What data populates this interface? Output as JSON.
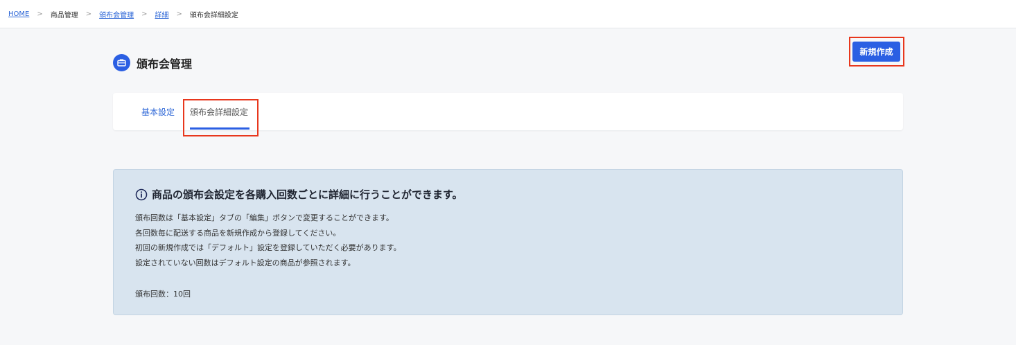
{
  "breadcrumb": {
    "items": [
      {
        "label": "HOME",
        "link": true
      },
      {
        "label": "商品管理",
        "link": false
      },
      {
        "label": "頒布会管理",
        "link": true
      },
      {
        "label": "詳細",
        "link": true
      },
      {
        "label": "頒布会詳細設定",
        "link": false
      }
    ],
    "separator": ">"
  },
  "header": {
    "title": "頒布会管理",
    "title_icon": "briefcase-icon",
    "new_button_label": "新規作成"
  },
  "tabs": [
    {
      "label": "基本設定",
      "active": false
    },
    {
      "label": "頒布会詳細設定",
      "active": true
    }
  ],
  "info": {
    "icon": "info-circle-icon",
    "heading": "商品の頒布会設定を各購入回数ごとに詳細に行うことができます。",
    "lines": [
      "頒布回数は「基本設定」タブの「編集」ボタンで変更することができます。",
      "各回数毎に配送する商品を新規作成から登録してください。",
      "初回の新規作成では「デフォルト」設定を登録していただく必要があります。",
      "設定されていない回数はデフォルト設定の商品が参照されます。"
    ],
    "count_label": "頒布回数：10回"
  },
  "colors": {
    "accent": "#2b5fe3",
    "highlight": "#e8371d",
    "info_background": "#d8e4ef"
  }
}
